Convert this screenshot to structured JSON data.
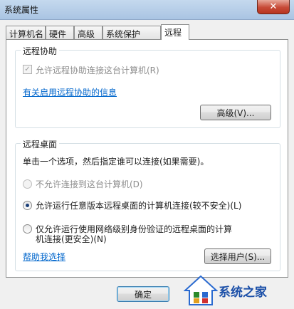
{
  "window": {
    "title": "系统属性",
    "close_glyph": "✕"
  },
  "tabs": [
    {
      "label": "计算机名"
    },
    {
      "label": "硬件"
    },
    {
      "label": "高级"
    },
    {
      "label": "系统保护"
    },
    {
      "label": "远程",
      "active": true
    }
  ],
  "remote_assistance": {
    "group_title": "远程协助",
    "checkbox_label": "允许远程协助连接这台计算机(R)",
    "checkbox_checked": true,
    "checkbox_enabled": false,
    "info_link": "有关启用远程协助的信息",
    "advanced_button": "高级(V)..."
  },
  "remote_desktop": {
    "group_title": "远程桌面",
    "instruction": "单击一个选项，然后指定谁可以连接(如果需要)。",
    "options": [
      {
        "label": "不允许连接到这台计算机(D)",
        "selected": false,
        "enabled": false
      },
      {
        "label": "允许运行任意版本远程桌面的计算机连接(较不安全)(L)",
        "selected": true,
        "enabled": true
      },
      {
        "label_line1": "仅允许运行使用网络级别身份验证的远程桌面的计算",
        "label_line2": "机连接(更安全)(N)",
        "selected": false,
        "enabled": true
      }
    ],
    "help_link": "帮助我选择",
    "select_users_button": "选择用户(S)..."
  },
  "footer": {
    "ok_button": "确定"
  },
  "watermark": {
    "text": "系统之家"
  },
  "colors": {
    "link": "#0066cc",
    "titlebar": "#b9d1ea",
    "close_button": "#c74a37",
    "disabled_text": "#8d8d8d",
    "watermark_text": "#1b4fa8"
  }
}
